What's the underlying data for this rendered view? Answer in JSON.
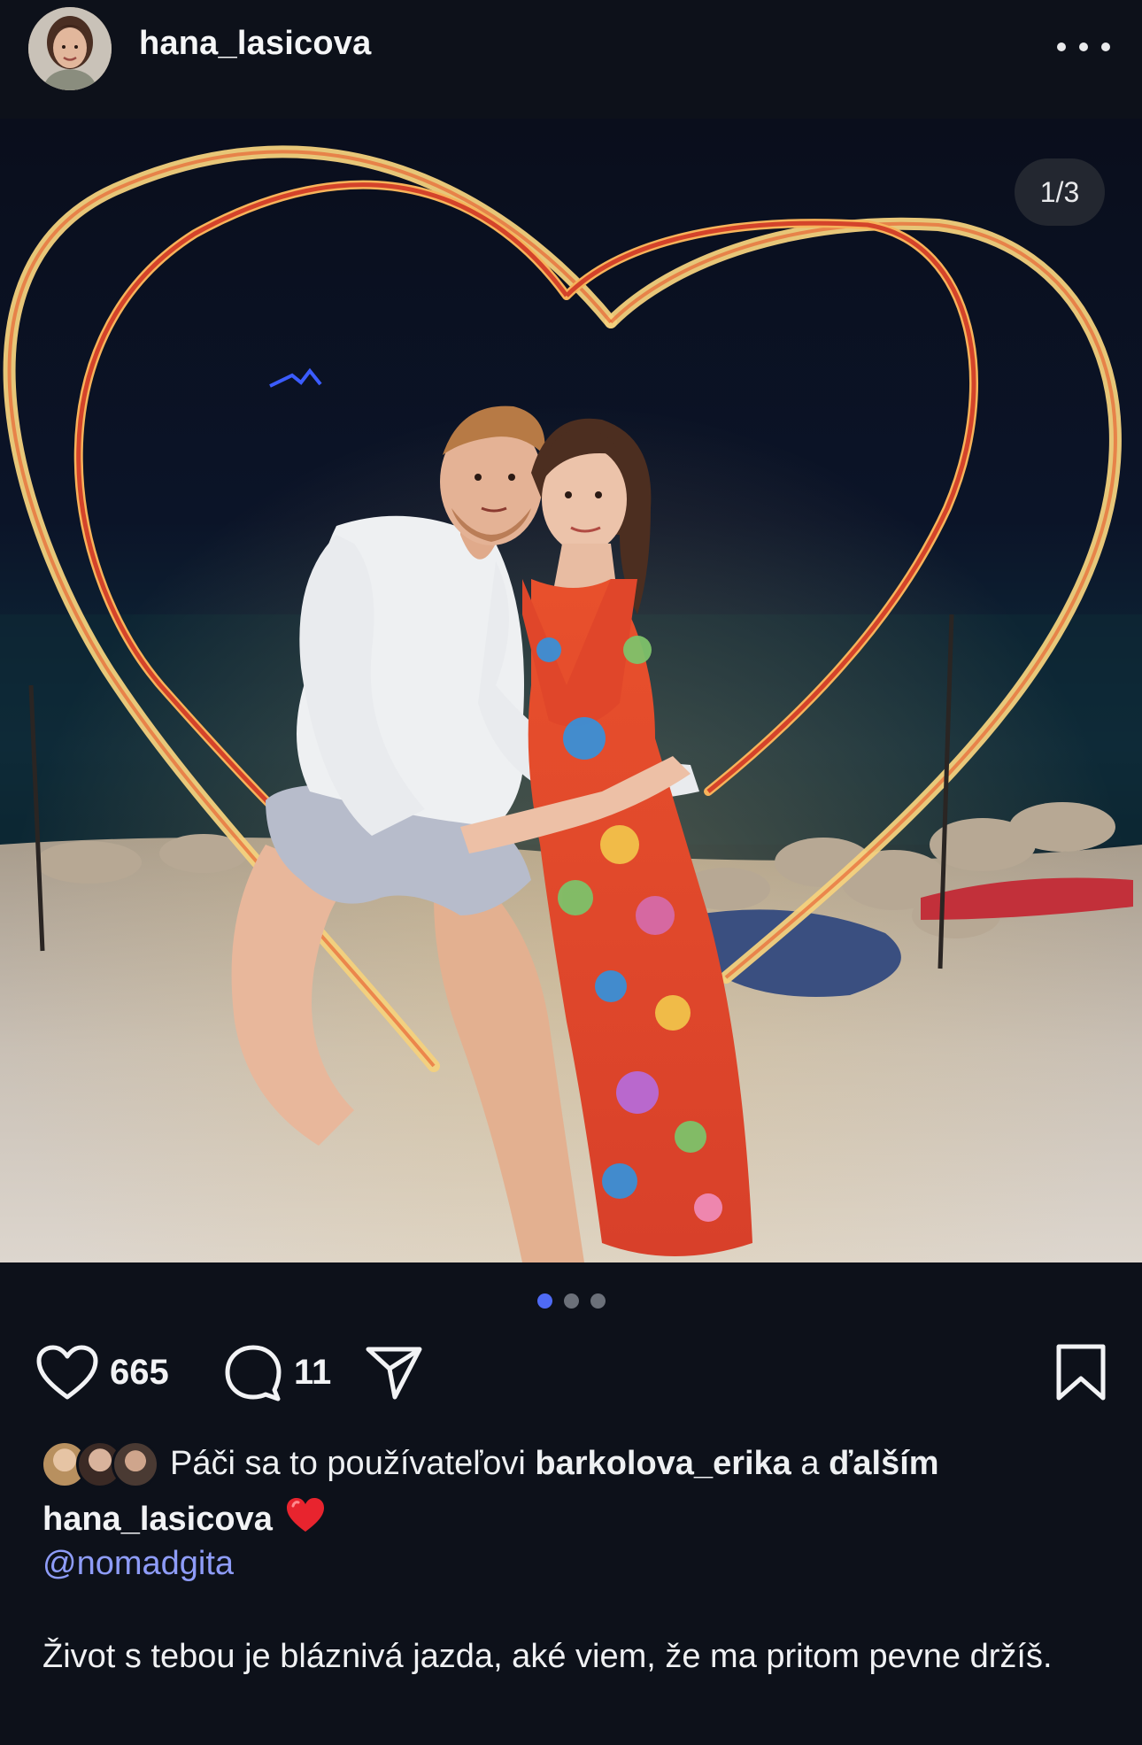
{
  "header": {
    "username": "hana_lasicova",
    "more_icon": "more-horizontal-icon"
  },
  "media": {
    "counter": "1/3",
    "active_index": 1,
    "total": 3
  },
  "actions": {
    "like_count": "665",
    "comment_count": "11",
    "icons": [
      "heart-icon",
      "comment-icon",
      "share-icon",
      "bookmark-icon"
    ]
  },
  "likes": {
    "prefix": "Páči sa to používateľovi ",
    "user": "barkolova_erika",
    "middle": " a ",
    "others": "ďalším"
  },
  "caption": {
    "username": "hana_lasicova",
    "emoji": "❤️",
    "mention": "@nomadgita",
    "text": "Život s tebou je bláznivá jazda, aké viem, že ma pritom pevne držíš."
  },
  "colors": {
    "background": "#0d111a",
    "accent_dot": "#4f6bf5",
    "mention": "#8e9cf8"
  }
}
